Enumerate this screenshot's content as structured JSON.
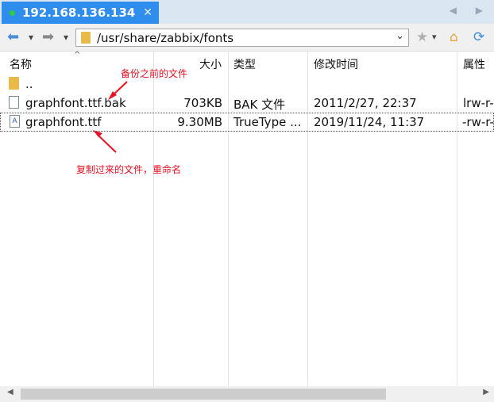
{
  "tab": {
    "title": "192.168.136.134",
    "close": "✕"
  },
  "tab_nav": "◀ ▶",
  "toolbar": {
    "back": "⬅",
    "back_menu": "▾",
    "forward": "➡",
    "forward_menu": "▾",
    "path": "/usr/share/zabbix/fonts",
    "path_dropdown": "⌄",
    "star": "★",
    "star_menu": "▾",
    "home": "⌂",
    "refresh": "⟳"
  },
  "columns": {
    "name": "名称",
    "size": "大小",
    "type": "类型",
    "modified": "修改时间",
    "attributes": "属性",
    "sort_indicator": "^"
  },
  "files": [
    {
      "name": "..",
      "size": "",
      "type": "",
      "modified": "",
      "attributes": "",
      "icon": "folder-icon"
    },
    {
      "name": "graphfont.ttf.bak",
      "size": "703KB",
      "type": "BAK 文件",
      "modified": "2011/2/27, 22:37",
      "attributes": "lrw-r-",
      "icon": "document-icon"
    },
    {
      "name": "graphfont.ttf",
      "size": "9.30MB",
      "type": "TrueType ...",
      "modified": "2019/11/24, 11:37",
      "attributes": "-rw-r-",
      "icon": "font-file-icon"
    }
  ],
  "annotations": {
    "backup": "备份之前的文件",
    "copied": "复制过来的文件，重命名"
  },
  "colors": {
    "tab_active": "#2f8ded",
    "annotation": "#e81123",
    "folder": "#e9b949"
  }
}
